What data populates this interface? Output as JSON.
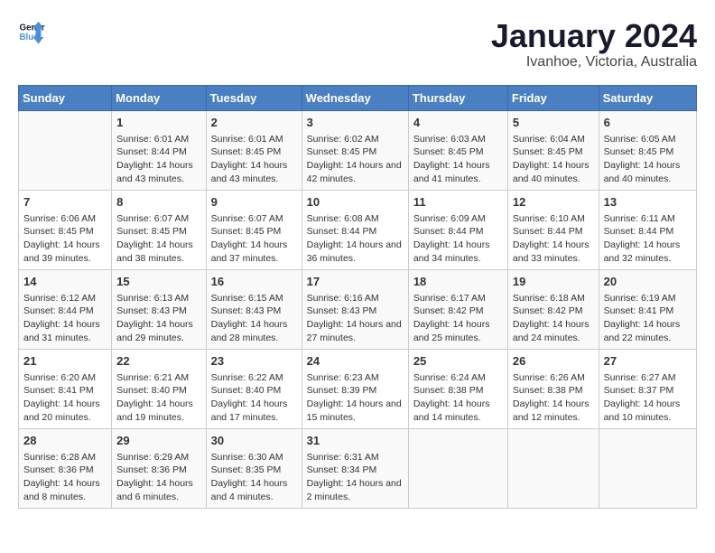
{
  "logo": {
    "line1": "General",
    "line2": "Blue"
  },
  "title": "January 2024",
  "location": "Ivanhoe, Victoria, Australia",
  "headers": [
    "Sunday",
    "Monday",
    "Tuesday",
    "Wednesday",
    "Thursday",
    "Friday",
    "Saturday"
  ],
  "weeks": [
    [
      {
        "day": "",
        "sunrise": "",
        "sunset": "",
        "daylight": ""
      },
      {
        "day": "1",
        "sunrise": "Sunrise: 6:01 AM",
        "sunset": "Sunset: 8:44 PM",
        "daylight": "Daylight: 14 hours and 43 minutes."
      },
      {
        "day": "2",
        "sunrise": "Sunrise: 6:01 AM",
        "sunset": "Sunset: 8:45 PM",
        "daylight": "Daylight: 14 hours and 43 minutes."
      },
      {
        "day": "3",
        "sunrise": "Sunrise: 6:02 AM",
        "sunset": "Sunset: 8:45 PM",
        "daylight": "Daylight: 14 hours and 42 minutes."
      },
      {
        "day": "4",
        "sunrise": "Sunrise: 6:03 AM",
        "sunset": "Sunset: 8:45 PM",
        "daylight": "Daylight: 14 hours and 41 minutes."
      },
      {
        "day": "5",
        "sunrise": "Sunrise: 6:04 AM",
        "sunset": "Sunset: 8:45 PM",
        "daylight": "Daylight: 14 hours and 40 minutes."
      },
      {
        "day": "6",
        "sunrise": "Sunrise: 6:05 AM",
        "sunset": "Sunset: 8:45 PM",
        "daylight": "Daylight: 14 hours and 40 minutes."
      }
    ],
    [
      {
        "day": "7",
        "sunrise": "Sunrise: 6:06 AM",
        "sunset": "Sunset: 8:45 PM",
        "daylight": "Daylight: 14 hours and 39 minutes."
      },
      {
        "day": "8",
        "sunrise": "Sunrise: 6:07 AM",
        "sunset": "Sunset: 8:45 PM",
        "daylight": "Daylight: 14 hours and 38 minutes."
      },
      {
        "day": "9",
        "sunrise": "Sunrise: 6:07 AM",
        "sunset": "Sunset: 8:45 PM",
        "daylight": "Daylight: 14 hours and 37 minutes."
      },
      {
        "day": "10",
        "sunrise": "Sunrise: 6:08 AM",
        "sunset": "Sunset: 8:44 PM",
        "daylight": "Daylight: 14 hours and 36 minutes."
      },
      {
        "day": "11",
        "sunrise": "Sunrise: 6:09 AM",
        "sunset": "Sunset: 8:44 PM",
        "daylight": "Daylight: 14 hours and 34 minutes."
      },
      {
        "day": "12",
        "sunrise": "Sunrise: 6:10 AM",
        "sunset": "Sunset: 8:44 PM",
        "daylight": "Daylight: 14 hours and 33 minutes."
      },
      {
        "day": "13",
        "sunrise": "Sunrise: 6:11 AM",
        "sunset": "Sunset: 8:44 PM",
        "daylight": "Daylight: 14 hours and 32 minutes."
      }
    ],
    [
      {
        "day": "14",
        "sunrise": "Sunrise: 6:12 AM",
        "sunset": "Sunset: 8:44 PM",
        "daylight": "Daylight: 14 hours and 31 minutes."
      },
      {
        "day": "15",
        "sunrise": "Sunrise: 6:13 AM",
        "sunset": "Sunset: 8:43 PM",
        "daylight": "Daylight: 14 hours and 29 minutes."
      },
      {
        "day": "16",
        "sunrise": "Sunrise: 6:15 AM",
        "sunset": "Sunset: 8:43 PM",
        "daylight": "Daylight: 14 hours and 28 minutes."
      },
      {
        "day": "17",
        "sunrise": "Sunrise: 6:16 AM",
        "sunset": "Sunset: 8:43 PM",
        "daylight": "Daylight: 14 hours and 27 minutes."
      },
      {
        "day": "18",
        "sunrise": "Sunrise: 6:17 AM",
        "sunset": "Sunset: 8:42 PM",
        "daylight": "Daylight: 14 hours and 25 minutes."
      },
      {
        "day": "19",
        "sunrise": "Sunrise: 6:18 AM",
        "sunset": "Sunset: 8:42 PM",
        "daylight": "Daylight: 14 hours and 24 minutes."
      },
      {
        "day": "20",
        "sunrise": "Sunrise: 6:19 AM",
        "sunset": "Sunset: 8:41 PM",
        "daylight": "Daylight: 14 hours and 22 minutes."
      }
    ],
    [
      {
        "day": "21",
        "sunrise": "Sunrise: 6:20 AM",
        "sunset": "Sunset: 8:41 PM",
        "daylight": "Daylight: 14 hours and 20 minutes."
      },
      {
        "day": "22",
        "sunrise": "Sunrise: 6:21 AM",
        "sunset": "Sunset: 8:40 PM",
        "daylight": "Daylight: 14 hours and 19 minutes."
      },
      {
        "day": "23",
        "sunrise": "Sunrise: 6:22 AM",
        "sunset": "Sunset: 8:40 PM",
        "daylight": "Daylight: 14 hours and 17 minutes."
      },
      {
        "day": "24",
        "sunrise": "Sunrise: 6:23 AM",
        "sunset": "Sunset: 8:39 PM",
        "daylight": "Daylight: 14 hours and 15 minutes."
      },
      {
        "day": "25",
        "sunrise": "Sunrise: 6:24 AM",
        "sunset": "Sunset: 8:38 PM",
        "daylight": "Daylight: 14 hours and 14 minutes."
      },
      {
        "day": "26",
        "sunrise": "Sunrise: 6:26 AM",
        "sunset": "Sunset: 8:38 PM",
        "daylight": "Daylight: 14 hours and 12 minutes."
      },
      {
        "day": "27",
        "sunrise": "Sunrise: 6:27 AM",
        "sunset": "Sunset: 8:37 PM",
        "daylight": "Daylight: 14 hours and 10 minutes."
      }
    ],
    [
      {
        "day": "28",
        "sunrise": "Sunrise: 6:28 AM",
        "sunset": "Sunset: 8:36 PM",
        "daylight": "Daylight: 14 hours and 8 minutes."
      },
      {
        "day": "29",
        "sunrise": "Sunrise: 6:29 AM",
        "sunset": "Sunset: 8:36 PM",
        "daylight": "Daylight: 14 hours and 6 minutes."
      },
      {
        "day": "30",
        "sunrise": "Sunrise: 6:30 AM",
        "sunset": "Sunset: 8:35 PM",
        "daylight": "Daylight: 14 hours and 4 minutes."
      },
      {
        "day": "31",
        "sunrise": "Sunrise: 6:31 AM",
        "sunset": "Sunset: 8:34 PM",
        "daylight": "Daylight: 14 hours and 2 minutes."
      },
      {
        "day": "",
        "sunrise": "",
        "sunset": "",
        "daylight": ""
      },
      {
        "day": "",
        "sunrise": "",
        "sunset": "",
        "daylight": ""
      },
      {
        "day": "",
        "sunrise": "",
        "sunset": "",
        "daylight": ""
      }
    ]
  ]
}
